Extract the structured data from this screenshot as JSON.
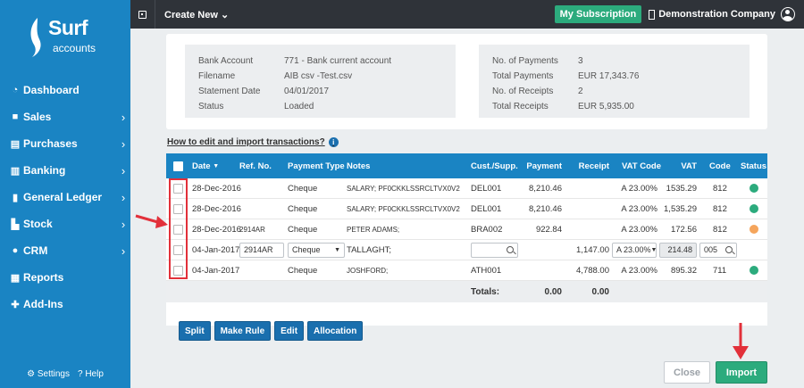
{
  "brand": {
    "name": "Surf",
    "sub": "accounts"
  },
  "sidebar": {
    "items": [
      {
        "label": "Dashboard",
        "has_children": false,
        "icon": "dashboard-icon"
      },
      {
        "label": "Sales",
        "has_children": true,
        "icon": "briefcase-icon"
      },
      {
        "label": "Purchases",
        "has_children": true,
        "icon": "list-icon"
      },
      {
        "label": "Banking",
        "has_children": true,
        "icon": "bank-icon"
      },
      {
        "label": "General Ledger",
        "has_children": true,
        "icon": "file-icon"
      },
      {
        "label": "Stock",
        "has_children": true,
        "icon": "bar-chart-icon"
      },
      {
        "label": "CRM",
        "has_children": true,
        "icon": "globe-icon"
      },
      {
        "label": "Reports",
        "has_children": false,
        "icon": "grid-icon"
      },
      {
        "label": "Add-Ins",
        "has_children": false,
        "icon": "puzzle-icon"
      }
    ],
    "settings_label": "Settings",
    "help_label": "Help"
  },
  "topbar": {
    "create_label": "Create New",
    "subscription_label": "My Subscription",
    "company_label": "Demonstration Company"
  },
  "summary": {
    "left": [
      {
        "label": "Bank Account",
        "value": "771 - Bank current account"
      },
      {
        "label": "Filename",
        "value": "AIB csv -Test.csv"
      },
      {
        "label": "Statement Date",
        "value": "04/01/2017"
      },
      {
        "label": "Status",
        "value": "Loaded"
      }
    ],
    "right": [
      {
        "label": "No. of Payments",
        "value": "3"
      },
      {
        "label": "Total Payments",
        "value": "EUR 17,343.76"
      },
      {
        "label": "No. of Receipts",
        "value": "2"
      },
      {
        "label": "Total Receipts",
        "value": "EUR 5,935.00"
      }
    ]
  },
  "howto_link": "How to edit and import transactions?",
  "table": {
    "headers": {
      "date": "Date",
      "ref": "Ref. No.",
      "payment_type": "Payment Type",
      "notes": "Notes",
      "cust": "Cust./Supp.",
      "payment": "Payment",
      "receipt": "Receipt",
      "vat_code": "VAT Code",
      "vat": "VAT",
      "code": "Code",
      "status": "Status"
    },
    "rows": [
      {
        "date": "28-Dec-2016",
        "ref": "",
        "type": "Cheque",
        "notes": "SALARY; PF0CKKLSSRCLTVX0V2",
        "cust": "DEL001",
        "payment": "8,210.46",
        "receipt": "",
        "vat_code": "A 23.00%",
        "vat": "1535.29",
        "code": "812",
        "status_color": "#2cab7d"
      },
      {
        "date": "28-Dec-2016",
        "ref": "",
        "type": "Cheque",
        "notes": "SALARY; PF0CKKLSSRCLTVX0V2",
        "cust": "DEL001",
        "payment": "8,210.46",
        "receipt": "",
        "vat_code": "A 23.00%",
        "vat": "1,535.29",
        "code": "812",
        "status_color": "#2cab7d"
      },
      {
        "date": "28-Dec-2016",
        "ref": "2914AR",
        "type": "Cheque",
        "notes": "PETER ADAMS;",
        "cust": "BRA002",
        "payment": "922.84",
        "receipt": "",
        "vat_code": "A 23.00%",
        "vat": "172.56",
        "code": "812",
        "status_color": "#f5a55c"
      }
    ],
    "edit_row": {
      "date": "04-Jan-2017",
      "ref": "2914AR",
      "type": "Cheque",
      "notes": "TALLAGHT;",
      "cust": "",
      "receipt": "1,147.00",
      "vat_code": "A 23.00%",
      "vat": "214.48",
      "code": "005"
    },
    "last_row": {
      "date": "04-Jan-2017",
      "ref": "",
      "type": "Cheque",
      "notes": "JOSHFORD;",
      "cust": "ATH001",
      "payment": "",
      "receipt": "4,788.00",
      "vat_code": "A 23.00%",
      "vat": "895.32",
      "code": "711",
      "status_color": "#2cab7d"
    },
    "totals_label": "Totals:",
    "totals_payment": "0.00",
    "totals_receipt": "0.00"
  },
  "actions": {
    "split": "Split",
    "make_rule": "Make Rule",
    "edit": "Edit",
    "allocation": "Allocation"
  },
  "footer": {
    "close": "Close",
    "import": "Import"
  },
  "colors": {
    "sidebar": "#1a84c3",
    "topbar": "#2f3339",
    "accent_green": "#2cab7d",
    "header_blue": "#1a84c3",
    "annotation_red": "#e2303a"
  }
}
